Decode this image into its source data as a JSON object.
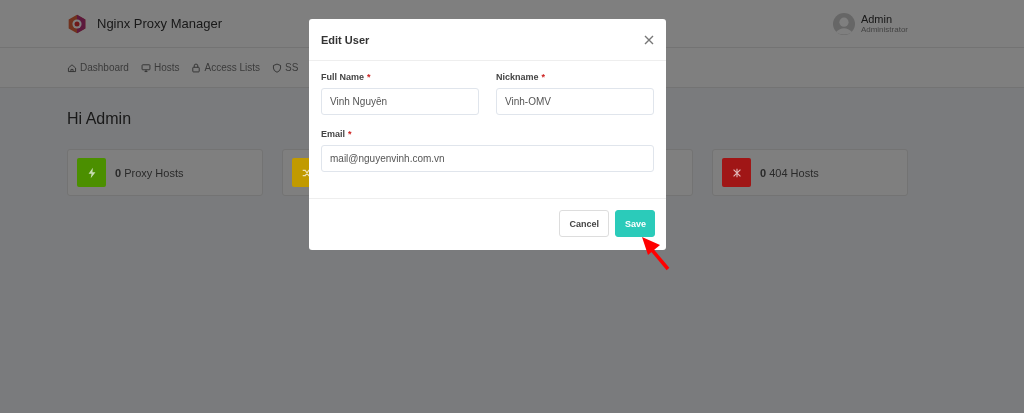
{
  "header": {
    "title": "Nginx Proxy Manager",
    "user": {
      "name": "Admin",
      "role": "Administrator"
    }
  },
  "nav": [
    {
      "label": "Dashboard"
    },
    {
      "label": "Hosts"
    },
    {
      "label": "Access Lists"
    },
    {
      "label": "SS"
    }
  ],
  "greeting": "Hi Admin",
  "stats": [
    {
      "kind": "stat",
      "color": "#4b8f00",
      "count": "0",
      "label": "Proxy Hosts"
    },
    {
      "kind": "stat",
      "color": "#c19a00"
    },
    {
      "kind": "stat"
    },
    {
      "kind": "stat",
      "color": "#a01616",
      "count": "0",
      "label": "404 Hosts"
    }
  ],
  "dialog": {
    "title": "Edit User",
    "fields": [
      {
        "label": "Full Name",
        "required_mark": "*",
        "value": "Vinh Nguyễn"
      },
      {
        "label": "Nickname",
        "required_mark": "*",
        "value": "Vinh-OMV"
      },
      {
        "label": "Email",
        "required_mark": "*",
        "value": "mail@nguyenvinh.com.vn"
      }
    ],
    "buttons": [
      {
        "label": "Cancel",
        "kind": "secondary"
      },
      {
        "label": "Save",
        "kind": "primary"
      }
    ]
  }
}
